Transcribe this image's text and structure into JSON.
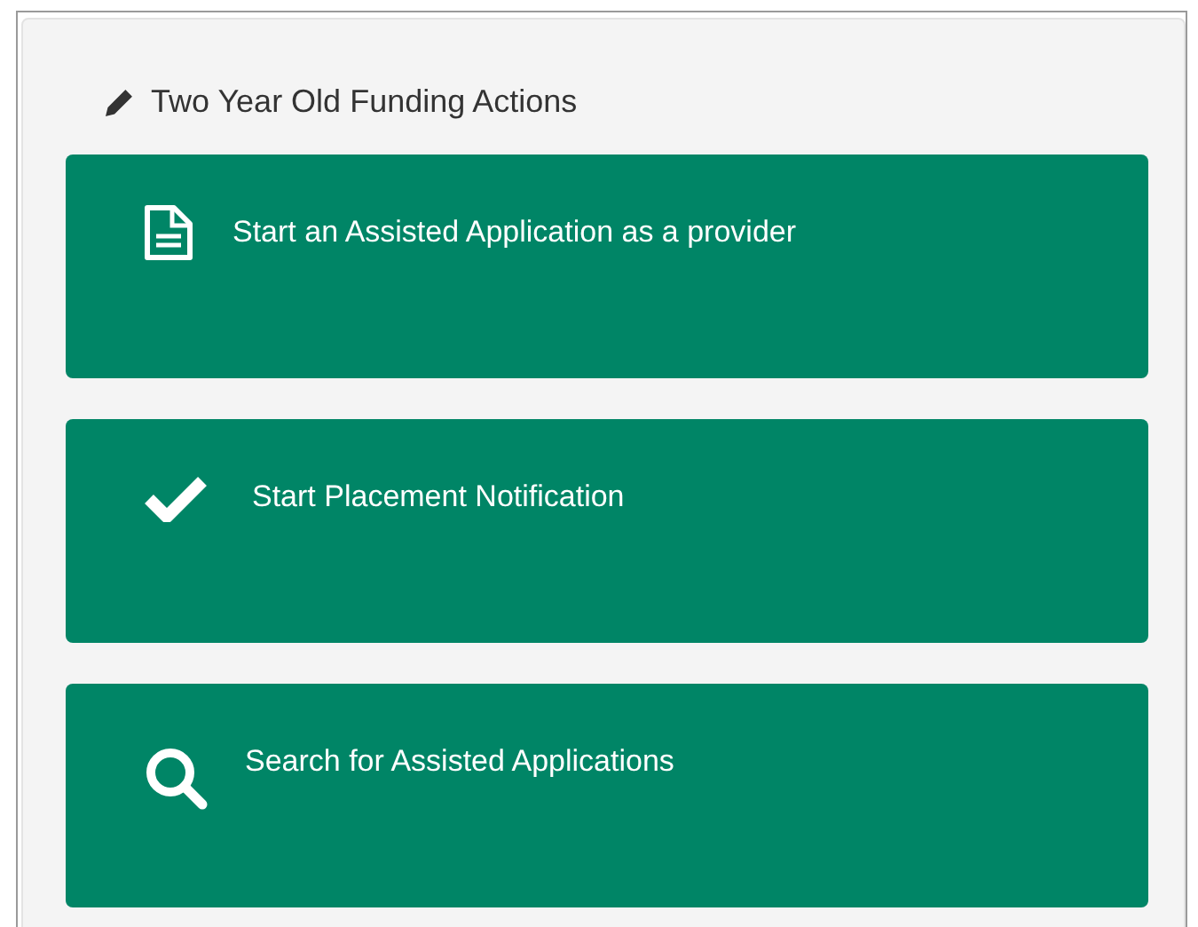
{
  "panel": {
    "title": "Two Year Old Funding Actions"
  },
  "actions": [
    {
      "kind": "document",
      "label": "Start an Assisted Application as a provider"
    },
    {
      "kind": "check",
      "label": "Start Placement Notification"
    },
    {
      "kind": "search",
      "label": "Search for Assisted Applications"
    }
  ]
}
